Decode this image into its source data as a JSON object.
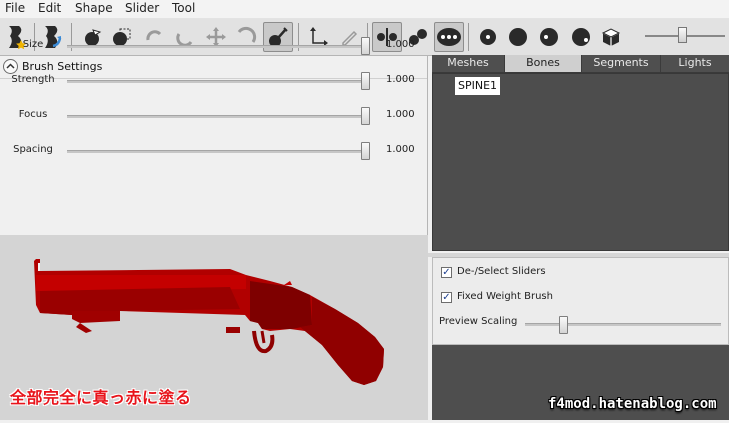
{
  "menu": [
    "File",
    "Edit",
    "Shape",
    "Slider",
    "Tool"
  ],
  "toolbar": {
    "icons": [
      "outfit-studio-star-icon",
      "mesh-blue-arrow-icon",
      "select-arrow-icon",
      "mask-brush-icon",
      "unmask-brush-icon",
      "inflate-brush-icon",
      "deflate-brush-icon",
      "move-brush-icon",
      "smooth-brush-icon",
      "weight-brush-icon",
      "transform-icon",
      "pen-icon",
      "vertex-select-icon",
      "pair-circles-icon",
      "three-dots-icon",
      "dot-small-icon",
      "dot-medium-icon",
      "dot-half-icon",
      "dot-large-icon",
      "cube-icon"
    ],
    "active_tool": "weight-brush-icon"
  },
  "brush": {
    "header": "Brush Settings",
    "rows": [
      {
        "label": "Size",
        "value": "1.000",
        "level": 1.0
      },
      {
        "label": "Strength",
        "value": "1.000",
        "level": 1.0
      },
      {
        "label": "Focus",
        "value": "1.000",
        "level": 1.0
      },
      {
        "label": "Spacing",
        "value": "1.000",
        "level": 1.0
      }
    ]
  },
  "tabs": [
    "Meshes",
    "Bones",
    "Segments",
    "Lights"
  ],
  "selected_tab": "Bones",
  "bones": [
    "SPINE1"
  ],
  "options": {
    "deselect_sliders": {
      "label": "De-/Select Sliders",
      "checked": true
    },
    "fixed_weight_brush": {
      "label": "Fixed Weight Brush",
      "checked": true
    },
    "preview_scaling": {
      "label": "Preview Scaling",
      "level": 0.2
    }
  },
  "caption": "全部完全に真っ赤に塗る",
  "watermark": "f4mod.hatenablog.com",
  "colors": {
    "weight_red": "#c60000",
    "dark_red": "#8e0000",
    "panel_dark": "#4d4d4d",
    "caption": "#e8141b"
  }
}
